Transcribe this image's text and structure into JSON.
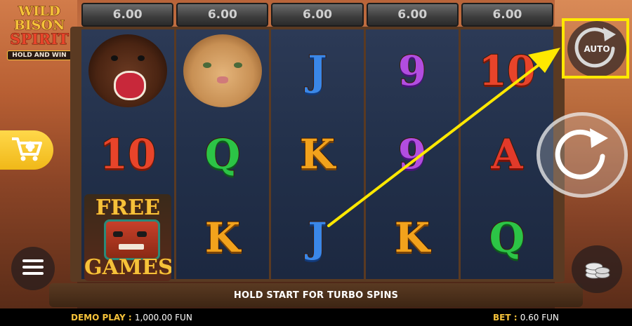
{
  "game": {
    "logo_line1": "WILD",
    "logo_line2": "BISON",
    "logo_line3": "SPIRIT",
    "logo_sub": "HOLD AND WIN"
  },
  "stakes": [
    "6.00",
    "6.00",
    "6.00",
    "6.00",
    "6.00"
  ],
  "reels": [
    [
      {
        "symbol": "bear"
      },
      {
        "symbol": "10"
      },
      {
        "symbol": "free-games"
      }
    ],
    [
      {
        "symbol": "cougar"
      },
      {
        "symbol": "Q"
      },
      {
        "symbol": "K"
      }
    ],
    [
      {
        "symbol": "J"
      },
      {
        "symbol": "K"
      },
      {
        "symbol": "J"
      }
    ],
    [
      {
        "symbol": "9"
      },
      {
        "symbol": "9"
      },
      {
        "symbol": "K"
      }
    ],
    [
      {
        "symbol": "10"
      },
      {
        "symbol": "A"
      },
      {
        "symbol": "Q"
      }
    ]
  ],
  "free_games": {
    "top": "FREE",
    "bottom": "GAMES"
  },
  "hint": "HOLD START FOR TURBO SPINS",
  "status": {
    "demo_label": "DEMO PLAY : ",
    "demo_value": "1,000.00 FUN",
    "bet_label": "BET : ",
    "bet_value": "0.60 FUN"
  },
  "buttons": {
    "auto_label": "AUTO"
  },
  "icons": {
    "cart": "shopping-cart-clover-icon",
    "menu": "hamburger-menu-icon",
    "auto": "auto-spin-icon",
    "spin": "spin-arrow-icon",
    "coins": "coin-stack-icon"
  },
  "colors": {
    "accent_yellow": "#f5c23a",
    "highlight": "#ffe800"
  }
}
